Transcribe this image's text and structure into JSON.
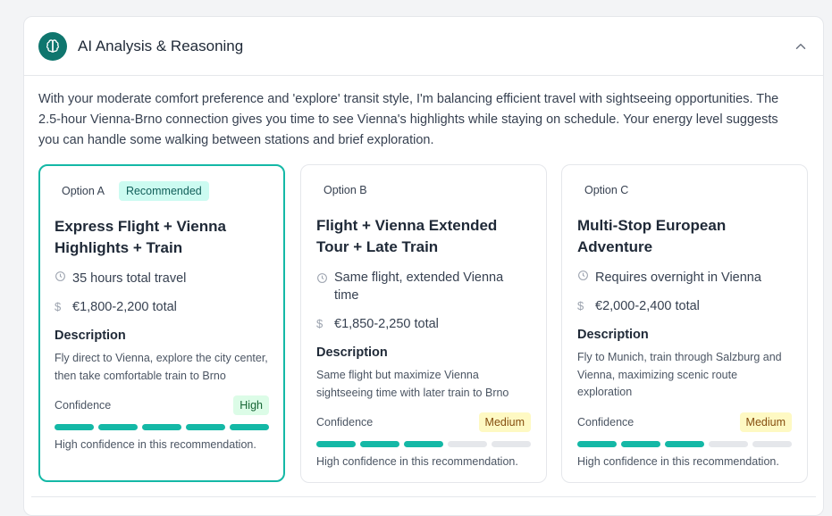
{
  "header": {
    "title": "AI Analysis & Reasoning",
    "icon": "brain-icon",
    "accent": "#0f766e"
  },
  "analysis": "With your moderate comfort preference and 'explore' transit style, I'm balancing efficient travel with sightseeing opportunities. The 2.5-hour Vienna-Brno connection gives you time to see Vienna's highlights while staying on schedule. Your energy level suggests you can handle some walking between stations and brief exploration.",
  "options": [
    {
      "label": "Option A",
      "badge": "Recommended",
      "title": "Express Flight + Vienna Highlights + Train",
      "time": "35 hours total travel",
      "cost": "€1,800-2,200 total",
      "description_heading": "Description",
      "description": "Fly direct to Vienna, explore the city center, then take comfortable train to Brno",
      "confidence_label": "Confidence",
      "confidence_level": "High",
      "confidence_score": 5,
      "confidence_max": 5,
      "confidence_note": "High confidence in this recommendation."
    },
    {
      "label": "Option B",
      "badge": "",
      "title": "Flight + Vienna Extended Tour + Late Train",
      "time": "Same flight, extended Vienna time",
      "cost": "€1,850-2,250 total",
      "description_heading": "Description",
      "description": "Same flight but maximize Vienna sightseeing time with later train to Brno",
      "confidence_label": "Confidence",
      "confidence_level": "Medium",
      "confidence_score": 3,
      "confidence_max": 5,
      "confidence_note": "High confidence in this recommendation."
    },
    {
      "label": "Option C",
      "badge": "",
      "title": "Multi-Stop European Adventure",
      "time": "Requires overnight in Vienna",
      "cost": "€2,000-2,400 total",
      "description_heading": "Description",
      "description": "Fly to Munich, train through Salzburg and Vienna, maximizing scenic route exploration",
      "confidence_label": "Confidence",
      "confidence_level": "Medium",
      "confidence_score": 3,
      "confidence_max": 5,
      "confidence_note": "High confidence in this recommendation."
    }
  ]
}
